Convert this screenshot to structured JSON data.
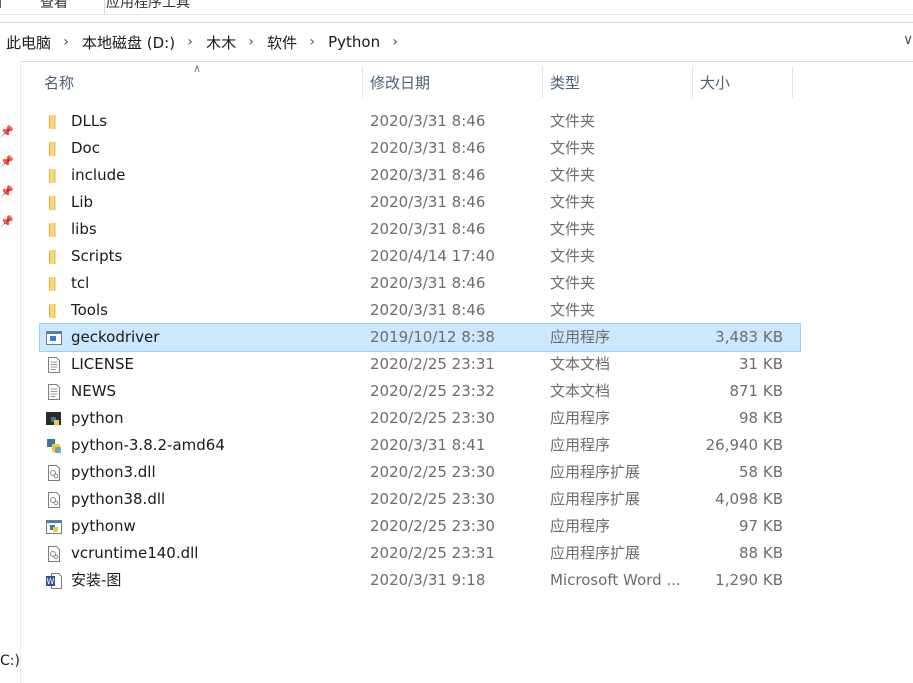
{
  "ribbon": {
    "tabs": [
      "查看",
      "应用程序工具"
    ]
  },
  "breadcrumb": [
    "此电脑",
    "本地磁盘 (D:)",
    "木木",
    "软件",
    "Python"
  ],
  "columns": {
    "name": "名称",
    "date": "修改日期",
    "type": "类型",
    "size": "大小"
  },
  "nav": {
    "drive_fragment": "C:)"
  },
  "files": [
    {
      "name": "DLLs",
      "date": "2020/3/31 8:46",
      "type": "文件夹",
      "size": "",
      "icon": "folder-icon"
    },
    {
      "name": "Doc",
      "date": "2020/3/31 8:46",
      "type": "文件夹",
      "size": "",
      "icon": "folder-icon"
    },
    {
      "name": "include",
      "date": "2020/3/31 8:46",
      "type": "文件夹",
      "size": "",
      "icon": "folder-icon"
    },
    {
      "name": "Lib",
      "date": "2020/3/31 8:46",
      "type": "文件夹",
      "size": "",
      "icon": "folder-icon"
    },
    {
      "name": "libs",
      "date": "2020/3/31 8:46",
      "type": "文件夹",
      "size": "",
      "icon": "folder-icon"
    },
    {
      "name": "Scripts",
      "date": "2020/4/14 17:40",
      "type": "文件夹",
      "size": "",
      "icon": "folder-icon"
    },
    {
      "name": "tcl",
      "date": "2020/3/31 8:46",
      "type": "文件夹",
      "size": "",
      "icon": "folder-icon"
    },
    {
      "name": "Tools",
      "date": "2020/3/31 8:46",
      "type": "文件夹",
      "size": "",
      "icon": "folder-icon"
    },
    {
      "name": "geckodriver",
      "date": "2019/10/12 8:38",
      "type": "应用程序",
      "size": "3,483 KB",
      "icon": "exe-icon",
      "selected": true
    },
    {
      "name": "LICENSE",
      "date": "2020/2/25 23:31",
      "type": "文本文档",
      "size": "31 KB",
      "icon": "text-file-icon"
    },
    {
      "name": "NEWS",
      "date": "2020/2/25 23:32",
      "type": "文本文档",
      "size": "871 KB",
      "icon": "text-file-icon"
    },
    {
      "name": "python",
      "date": "2020/2/25 23:30",
      "type": "应用程序",
      "size": "98 KB",
      "icon": "python-console-icon"
    },
    {
      "name": "python-3.8.2-amd64",
      "date": "2020/3/31 8:41",
      "type": "应用程序",
      "size": "26,940 KB",
      "icon": "python-installer-icon"
    },
    {
      "name": "python3.dll",
      "date": "2020/2/25 23:30",
      "type": "应用程序扩展",
      "size": "58 KB",
      "icon": "dll-icon"
    },
    {
      "name": "python38.dll",
      "date": "2020/2/25 23:30",
      "type": "应用程序扩展",
      "size": "4,098 KB",
      "icon": "dll-icon"
    },
    {
      "name": "pythonw",
      "date": "2020/2/25 23:30",
      "type": "应用程序",
      "size": "97 KB",
      "icon": "python-window-icon"
    },
    {
      "name": "vcruntime140.dll",
      "date": "2020/2/25 23:31",
      "type": "应用程序扩展",
      "size": "88 KB",
      "icon": "dll-icon"
    },
    {
      "name": "安装-图",
      "date": "2020/3/31 9:18",
      "type": "Microsoft Word ...",
      "size": "1,290 KB",
      "icon": "word-doc-icon"
    }
  ],
  "colors": {
    "selection": "#cce8ff",
    "selection_border": "#99d1ff",
    "folder": "#f8d775",
    "header_text": "#4c607a"
  }
}
